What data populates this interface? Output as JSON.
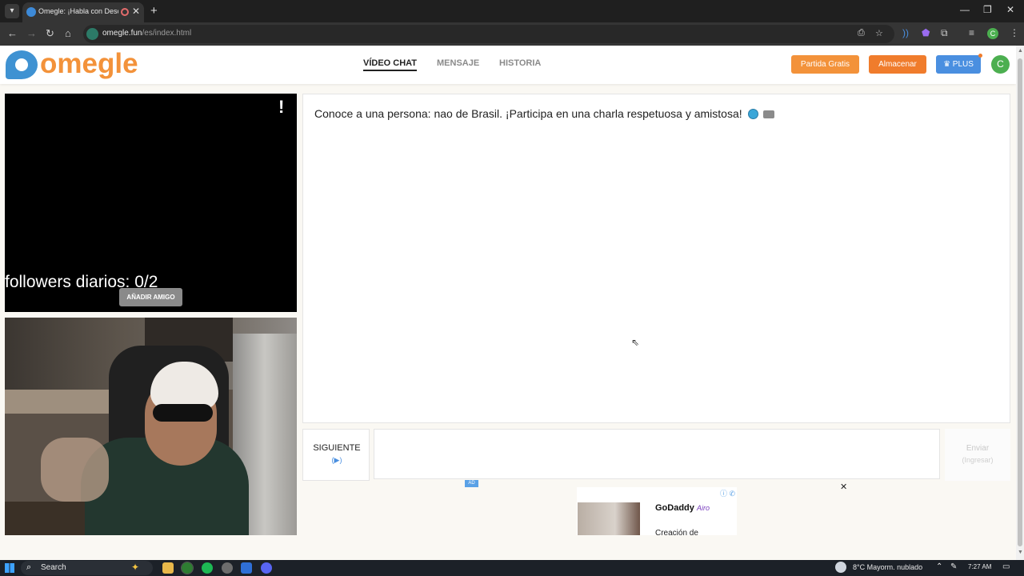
{
  "browser": {
    "tab_title": "Omegle: ¡Habla con Desconocidos!",
    "tab_close": "✕",
    "new_tab": "+",
    "url_host": "omegle.fun",
    "url_path": "/es/index.html",
    "window_minimize": "—",
    "window_restore": "❐",
    "window_close": "✕",
    "profile_initial": "C"
  },
  "site": {
    "logo_text": "omegle",
    "nav": [
      {
        "label": "VÍDEO CHAT",
        "active": true
      },
      {
        "label": "MENSAJE",
        "active": false
      },
      {
        "label": "HISTORIA",
        "active": false
      }
    ],
    "buttons": {
      "partida": "Partida Gratis",
      "almacenar": "Almacenar",
      "plus": "♛ PLUS"
    },
    "profile_initial": "C"
  },
  "video": {
    "report_mark": "!",
    "followers_text": "followers diarios: 0/2",
    "add_friend_label": "AÑADIR AMIGO"
  },
  "chat": {
    "message": "Conoce a una persona: nao de Brasil. ¡Participa en una charla respetuosa y amistosa!",
    "next_label": "SIGUIENTE",
    "next_hint": "(▶)",
    "input_value": "",
    "send_label": "Enviar",
    "send_hint": "(Ingresar)"
  },
  "ad": {
    "tag": "AD",
    "info": "ⓘ ✆",
    "brand": "GoDaddy",
    "brand_sub": "Airo",
    "text": "Creación de",
    "close": "✕"
  },
  "taskbar": {
    "search_label": "Search",
    "weather": "8°C  Mayorm. nublado",
    "time": "7:27 AM"
  },
  "colors": {
    "brand_orange": "#f3923a",
    "brand_blue": "#3f92d2",
    "plus_blue": "#4a8fe0"
  },
  "icons": [
    "chevron-down-icon",
    "favicon-icon",
    "record-icon",
    "close-icon",
    "plus-icon",
    "back-icon",
    "forward-icon",
    "reload-icon",
    "home-icon",
    "site-info-icon",
    "install-icon",
    "star-icon",
    "extension-icon",
    "profile-icon",
    "logo-icon",
    "globe-icon",
    "chat-icon",
    "windows-start-icon",
    "search-icon",
    "weather-icon",
    "notification-icon"
  ]
}
